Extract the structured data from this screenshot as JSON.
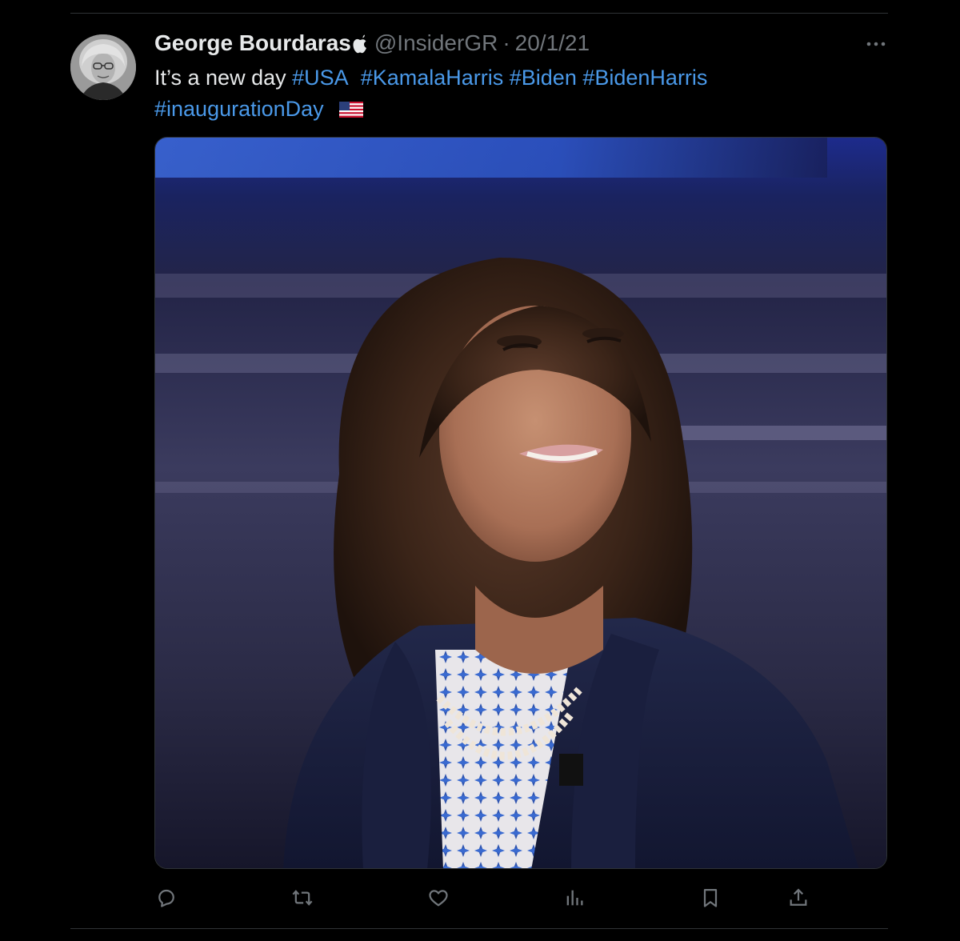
{
  "tweet": {
    "display_name": "George Bourdaras",
    "handle": "@InsiderGR",
    "separator": "·",
    "date": "20/1/21",
    "text_prefix": "It’s a new day",
    "hashtags": [
      "#USA",
      "#KamalaHarris",
      "#Biden",
      "#BidenHarris",
      "#inaugurationDay"
    ],
    "flag_icon": "us-flag-emoji",
    "media_description_icon": "photo"
  },
  "actions": [
    {
      "name": "reply",
      "icon": "reply-icon"
    },
    {
      "name": "retweet",
      "icon": "retweet-icon"
    },
    {
      "name": "like",
      "icon": "heart-icon"
    },
    {
      "name": "views",
      "icon": "analytics-icon"
    },
    {
      "name": "bookmark",
      "icon": "bookmark-icon"
    },
    {
      "name": "share",
      "icon": "share-icon"
    }
  ],
  "colors": {
    "background": "#000000",
    "text": "#e7e9ea",
    "secondary": "#71767b",
    "link": "#4a99e9",
    "divider": "#2f3336"
  }
}
